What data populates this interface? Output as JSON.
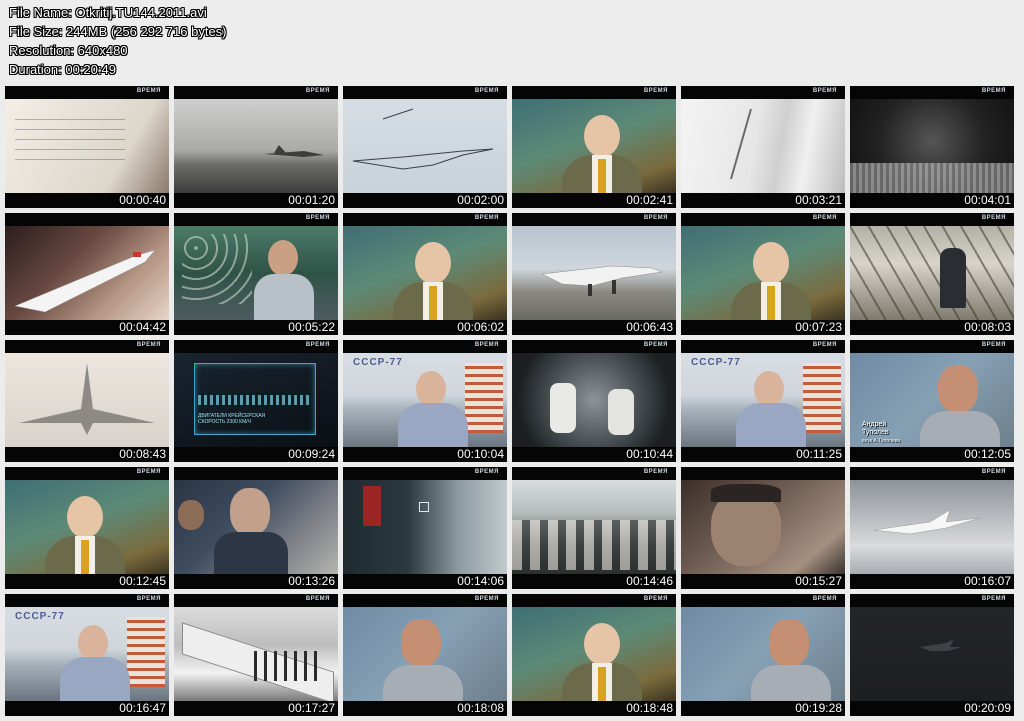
{
  "header": {
    "file_name": "File Name: Otkritij.TU144.2011.avi",
    "file_size": "File Size: 244MB (256 292 716 bytes)",
    "resolution": "Resolution: 640x480",
    "duration": "Duration: 00:20:49"
  },
  "channel_logo": "ВРЕМЯ",
  "thumbnails": [
    {
      "time": "00:00:40"
    },
    {
      "time": "00:01:20"
    },
    {
      "time": "00:02:00"
    },
    {
      "time": "00:02:41"
    },
    {
      "time": "00:03:21"
    },
    {
      "time": "00:04:01"
    },
    {
      "time": "00:04:42"
    },
    {
      "time": "00:05:22"
    },
    {
      "time": "00:06:02"
    },
    {
      "time": "00:06:43"
    },
    {
      "time": "00:07:23"
    },
    {
      "time": "00:08:03"
    },
    {
      "time": "00:08:43"
    },
    {
      "time": "00:09:24"
    },
    {
      "time": "00:10:04"
    },
    {
      "time": "00:10:44"
    },
    {
      "time": "00:11:25"
    },
    {
      "time": "00:12:05"
    },
    {
      "time": "00:12:45"
    },
    {
      "time": "00:13:26"
    },
    {
      "time": "00:14:06"
    },
    {
      "time": "00:14:46"
    },
    {
      "time": "00:15:27"
    },
    {
      "time": "00:16:07"
    },
    {
      "time": "00:16:47"
    },
    {
      "time": "00:17:27"
    },
    {
      "time": "00:18:08"
    },
    {
      "time": "00:18:48"
    },
    {
      "time": "00:19:28"
    },
    {
      "time": "00:20:09"
    }
  ],
  "aircraft_marking": "СССР-77",
  "caption": {
    "name": "Андрей Туполев",
    "subtitle": "внук А.Туполева"
  },
  "ui_panel_text": "ДВИГАТЕЛИ КРЕЙСЕРСКАЯ СКОРОСТЬ 2300 КМ/Ч"
}
